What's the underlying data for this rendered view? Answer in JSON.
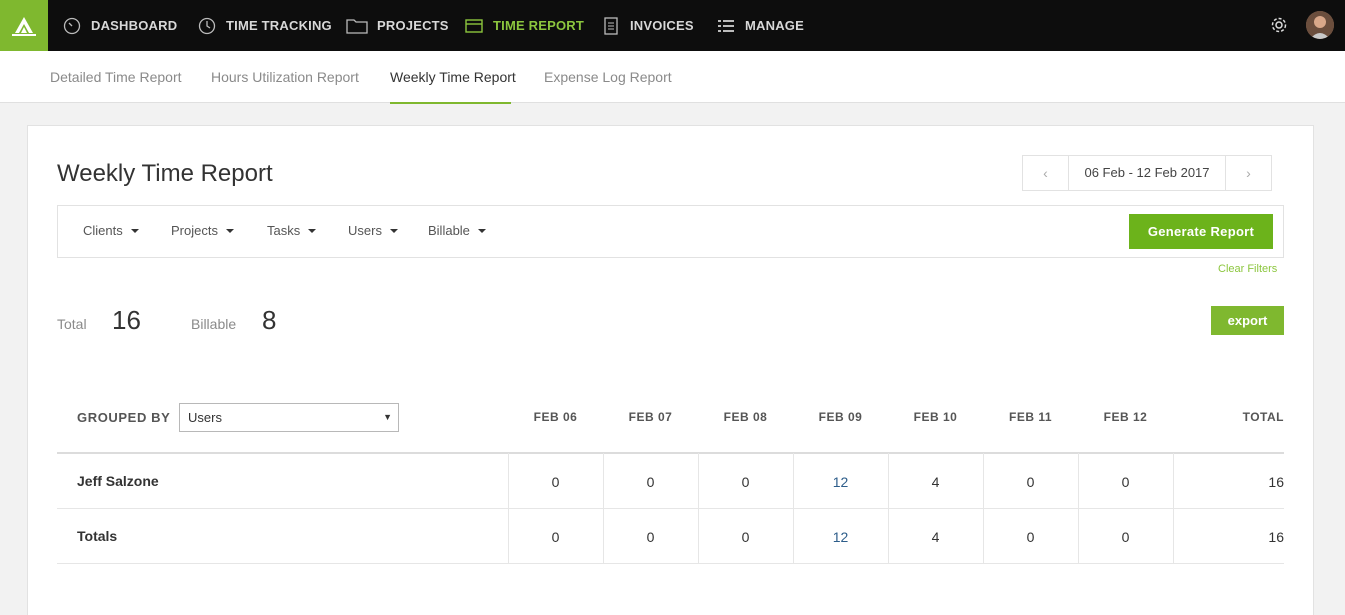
{
  "topnav": {
    "items": [
      {
        "label": "DASHBOARD",
        "icon": "dashboard-icon"
      },
      {
        "label": "TIME TRACKING",
        "icon": "clock-icon"
      },
      {
        "label": "PROJECTS",
        "icon": "folder-icon"
      },
      {
        "label": "TIME REPORT",
        "icon": "report-icon",
        "active": true
      },
      {
        "label": "INVOICES",
        "icon": "invoice-icon"
      },
      {
        "label": "MANAGE",
        "icon": "list-icon"
      }
    ],
    "accent_color": "#8cc63e"
  },
  "subnav": {
    "tabs": [
      {
        "label": "Detailed Time Report"
      },
      {
        "label": "Hours Utilization Report"
      },
      {
        "label": "Weekly Time Report",
        "active": true
      },
      {
        "label": "Expense Log Report"
      }
    ]
  },
  "page": {
    "title": "Weekly Time Report",
    "date_range": "06 Feb - 12 Feb 2017"
  },
  "filters": {
    "items": [
      "Clients",
      "Projects",
      "Tasks",
      "Users",
      "Billable"
    ],
    "generate_label": "Generate Report",
    "clear_label": "Clear Filters"
  },
  "stats": {
    "total_label": "Total",
    "total_value": "16",
    "billable_label": "Billable",
    "billable_value": "8",
    "export_label": "export"
  },
  "table": {
    "grouped_by_label": "GROUPED BY",
    "grouped_by_value": "Users",
    "columns": [
      "FEB 06",
      "FEB 07",
      "FEB 08",
      "FEB 09",
      "FEB 10",
      "FEB 11",
      "FEB 12"
    ],
    "total_label": "TOTAL",
    "rows": [
      {
        "name": "Jeff Salzone",
        "values": [
          "0",
          "0",
          "0",
          "12",
          "4",
          "0",
          "0"
        ],
        "total": "16"
      },
      {
        "name": "Totals",
        "values": [
          "0",
          "0",
          "0",
          "12",
          "4",
          "0",
          "0"
        ],
        "total": "16"
      }
    ]
  }
}
